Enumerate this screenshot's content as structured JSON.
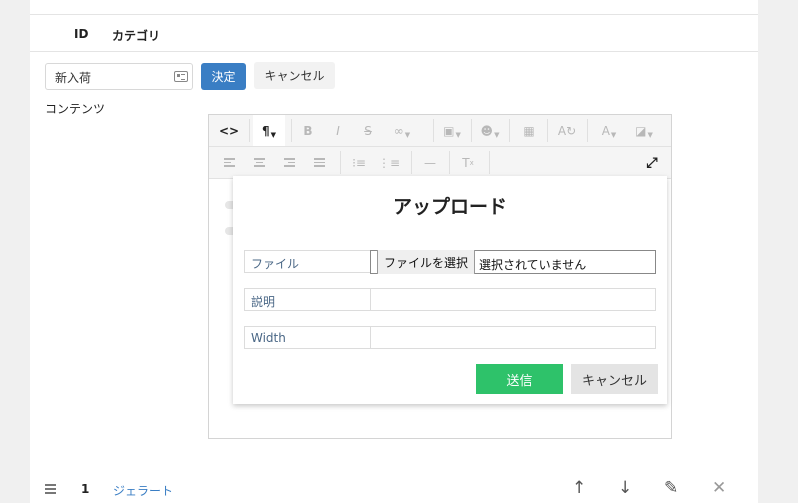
{
  "table": {
    "headers": [
      "ID",
      "カテゴリ"
    ]
  },
  "form": {
    "category_value": "新入荷",
    "ok_label": "決定",
    "cancel_label": "キャンセル",
    "content_label": "コンテンツ"
  },
  "toolbar": {
    "row1": [
      "code-view",
      "paragraph",
      "bold",
      "italic",
      "strikethrough",
      "link",
      "image",
      "emoji",
      "table",
      "text-direction",
      "font-color",
      "background-color"
    ],
    "row2": [
      "align-left",
      "align-center",
      "align-right",
      "align-justify",
      "bulleted-list",
      "numbered-list",
      "horizontal-rule",
      "clear-formatting",
      "fullscreen"
    ]
  },
  "dialog": {
    "title": "アップロード",
    "file_label": "ファイル",
    "file_button": "ファイルを選択",
    "file_status": "選択されていません",
    "description_label": "説明",
    "width_label": "Width",
    "send_label": "送信",
    "cancel_label": "キャンセル"
  },
  "row": {
    "id": "1",
    "category": "ジェラート"
  },
  "colors": {
    "accent": "#3a7ec4",
    "send": "#2ec26a",
    "label_text": "#4a6786"
  }
}
